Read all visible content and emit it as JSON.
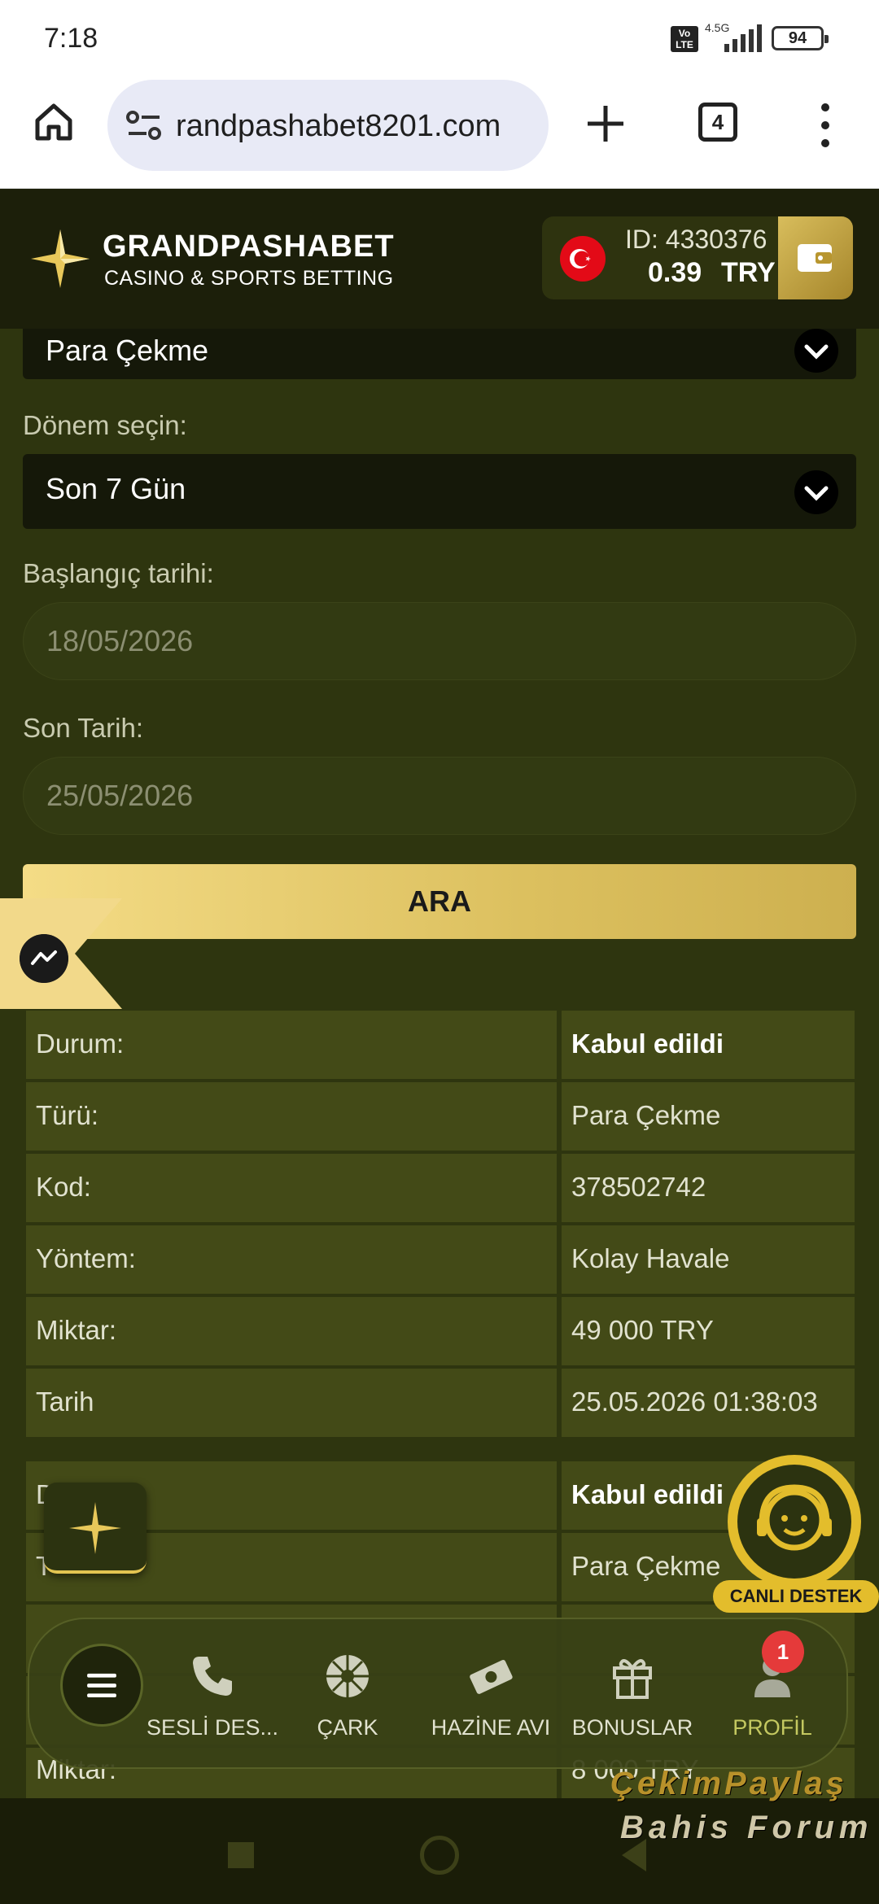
{
  "status_bar": {
    "time": "7:18",
    "volte": "Vo LTE",
    "network": "4.5G",
    "battery": "94"
  },
  "browser": {
    "url": "randpashabet8201.com",
    "tab_count": "4"
  },
  "header": {
    "brand": "GRANDPASHABET",
    "tagline": "CASINO & SPORTS BETTING",
    "account_id": "ID: 4330376",
    "balance": "0.39",
    "currency": "TRY"
  },
  "filters": {
    "type_value": "Para Çekme",
    "period_label": "Dönem seçin:",
    "period_value": "Son 7 Gün",
    "start_label": "Başlangıç tarihi:",
    "start_value": "18/05/2026",
    "end_label": "Son Tarih:",
    "end_value": "25/05/2026",
    "search_button": "ARA"
  },
  "transactions": [
    {
      "rows": [
        {
          "label": "Durum:",
          "value": "Kabul edildi"
        },
        {
          "label": "Türü:",
          "value": "Para Çekme"
        },
        {
          "label": "Kod:",
          "value": "378502742"
        },
        {
          "label": "Yöntem:",
          "value": "Kolay Havale"
        },
        {
          "label": "Miktar:",
          "value": "49 000 TRY"
        },
        {
          "label": "Tarih",
          "value": "25.05.2026 01:38:03"
        }
      ]
    },
    {
      "rows": [
        {
          "label": "D",
          "value": "Kabul edildi"
        },
        {
          "label": "T",
          "value": "Para Çekme"
        },
        {
          "label": "",
          "value": ""
        },
        {
          "label": "",
          "value": ""
        },
        {
          "label": "Miktar:",
          "value": "8 000 TRY"
        }
      ]
    }
  ],
  "support": {
    "label": "CANLI DESTEK"
  },
  "bottom_nav": {
    "items": [
      {
        "label": "SESLİ DES...",
        "icon": "phone-icon"
      },
      {
        "label": "ÇARK",
        "icon": "wheel-icon"
      },
      {
        "label": "HAZİNE AVI",
        "icon": "money-icon"
      },
      {
        "label": "BONUSLAR",
        "icon": "gift-icon"
      },
      {
        "label": "PROFİL",
        "icon": "user-icon"
      }
    ],
    "profile_badge": "1"
  },
  "watermark": {
    "line1": "ÇekimPaylaş",
    "line2": "Bahis Forum"
  },
  "colors": {
    "gold": "#dcc05f",
    "bg": "#2e350f",
    "row": "#434a17",
    "badge": "#e53a3a"
  }
}
